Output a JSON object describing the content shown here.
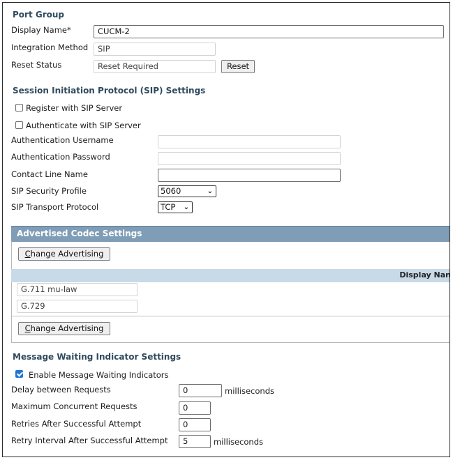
{
  "port_group": {
    "heading": "Port Group",
    "display_name_label": "Display Name*",
    "display_name_value": "CUCM-2",
    "integration_method_label": "Integration Method",
    "integration_method_value": "SIP",
    "reset_status_label": "Reset Status",
    "reset_status_value": "Reset Required",
    "reset_button": "Reset"
  },
  "sip": {
    "heading": "Session Initiation Protocol (SIP) Settings",
    "register_label": "Register with SIP Server",
    "register_checked": false,
    "authenticate_label": "Authenticate with SIP Server",
    "authenticate_checked": false,
    "auth_username_label": "Authentication Username",
    "auth_username_value": "",
    "auth_password_label": "Authentication Password",
    "auth_password_value": "",
    "contact_line_label": "Contact Line Name",
    "contact_line_value": "",
    "security_profile_label": "SIP Security Profile",
    "security_profile_value": "5060",
    "transport_label": "SIP Transport Protocol",
    "transport_value": "TCP"
  },
  "codec": {
    "heading": "Advertised Codec Settings",
    "change_button_prefix": "C",
    "change_button_rest": "hange Advertising",
    "column_header": "Display Nan",
    "codecs": [
      "G.711 mu-law",
      "G.729"
    ]
  },
  "mwi": {
    "heading": "Message Waiting Indicator Settings",
    "enable_label": "Enable Message Waiting Indicators",
    "enable_checked": true,
    "delay_label": "Delay between Requests",
    "delay_value": "0",
    "delay_unit": "milliseconds",
    "max_concurrent_label": "Maximum Concurrent Requests",
    "max_concurrent_value": "0",
    "retries_label": "Retries After Successful Attempt",
    "retries_value": "0",
    "retry_interval_label": "Retry Interval After Successful Attempt",
    "retry_interval_value": "5",
    "retry_interval_unit": "milliseconds"
  },
  "colors": {
    "heading": "#2f4a5d",
    "codec_header_bg": "#7f9db6",
    "column_bar_bg": "#c8d9e8",
    "checkbox_on": "#1f74d6"
  }
}
